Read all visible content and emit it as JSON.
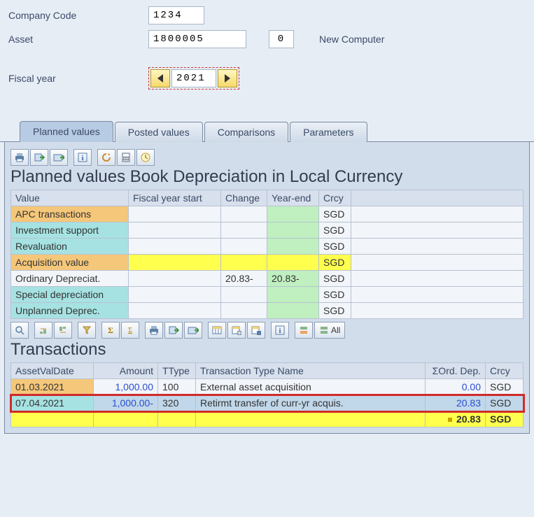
{
  "form": {
    "company_code_label": "Company Code",
    "company_code": "1234",
    "asset_label": "Asset",
    "asset": "1800005",
    "asset_sub": "0",
    "asset_desc": "New Computer",
    "fiscal_year_label": "Fiscal year",
    "fiscal_year": "2021"
  },
  "tabs": [
    "Planned values",
    "Posted values",
    "Comparisons",
    "Parameters"
  ],
  "toolbar2_all": "All",
  "planned": {
    "title": "Planned values Book Depreciation in Local Currency",
    "headers": {
      "value": "Value",
      "fys": "Fiscal year start",
      "change": "Change",
      "yearend": "Year-end",
      "crcy": "Crcy"
    },
    "rows": [
      {
        "style": "orange",
        "label": "APC transactions",
        "fys": "",
        "change": "",
        "yearend_green": true,
        "yearend": "",
        "crcy": "SGD"
      },
      {
        "style": "cyan",
        "label": "Investment support",
        "fys": "",
        "change": "",
        "yearend_green": true,
        "yearend": "",
        "crcy": "SGD"
      },
      {
        "style": "cyan",
        "label": "Revaluation",
        "fys": "",
        "change": "",
        "yearend_green": true,
        "yearend": "",
        "crcy": "SGD"
      },
      {
        "style": "orange",
        "label": "Acquisition value",
        "fys_yellow": true,
        "change_yellow": true,
        "yearend_yellow": true,
        "crcy_yellow": true,
        "fys": "",
        "change": "",
        "yearend": "",
        "crcy": "SGD"
      },
      {
        "style": "plain",
        "label": "Ordinary Depreciat.",
        "fys": "",
        "change": "20.83-",
        "yearend_green": true,
        "yearend": "20.83-",
        "crcy": "SGD"
      },
      {
        "style": "cyan",
        "label": "Special depreciation",
        "fys": "",
        "change": "",
        "yearend_green": true,
        "yearend": "",
        "crcy": "SGD"
      },
      {
        "style": "cyan",
        "label": "Unplanned Deprec.",
        "fys": "",
        "change": "",
        "yearend_green": true,
        "yearend": "",
        "crcy": "SGD"
      }
    ]
  },
  "transactions": {
    "title": "Transactions",
    "headers": {
      "date": "AssetValDate",
      "amount": "Amount",
      "ttype": "TType",
      "name": "Transaction Type Name",
      "dep": "ΣOrd. Dep.",
      "crcy": "Crcy"
    },
    "rows": [
      {
        "date": "01.03.2021",
        "amount": "1,000.00",
        "ttype": "100",
        "name": "External asset acquisition",
        "dep": "0.00",
        "crcy": "SGD",
        "highlight": false,
        "head": "orange"
      },
      {
        "date": "07.04.2021",
        "amount": "1,000.00-",
        "ttype": "320",
        "name": "Retirmt transfer of curr-yr acquis.",
        "dep": "20.83",
        "crcy": "SGD",
        "highlight": true,
        "head": "cyan"
      }
    ],
    "total": {
      "dep": "20.83",
      "crcy": "SGD"
    }
  }
}
